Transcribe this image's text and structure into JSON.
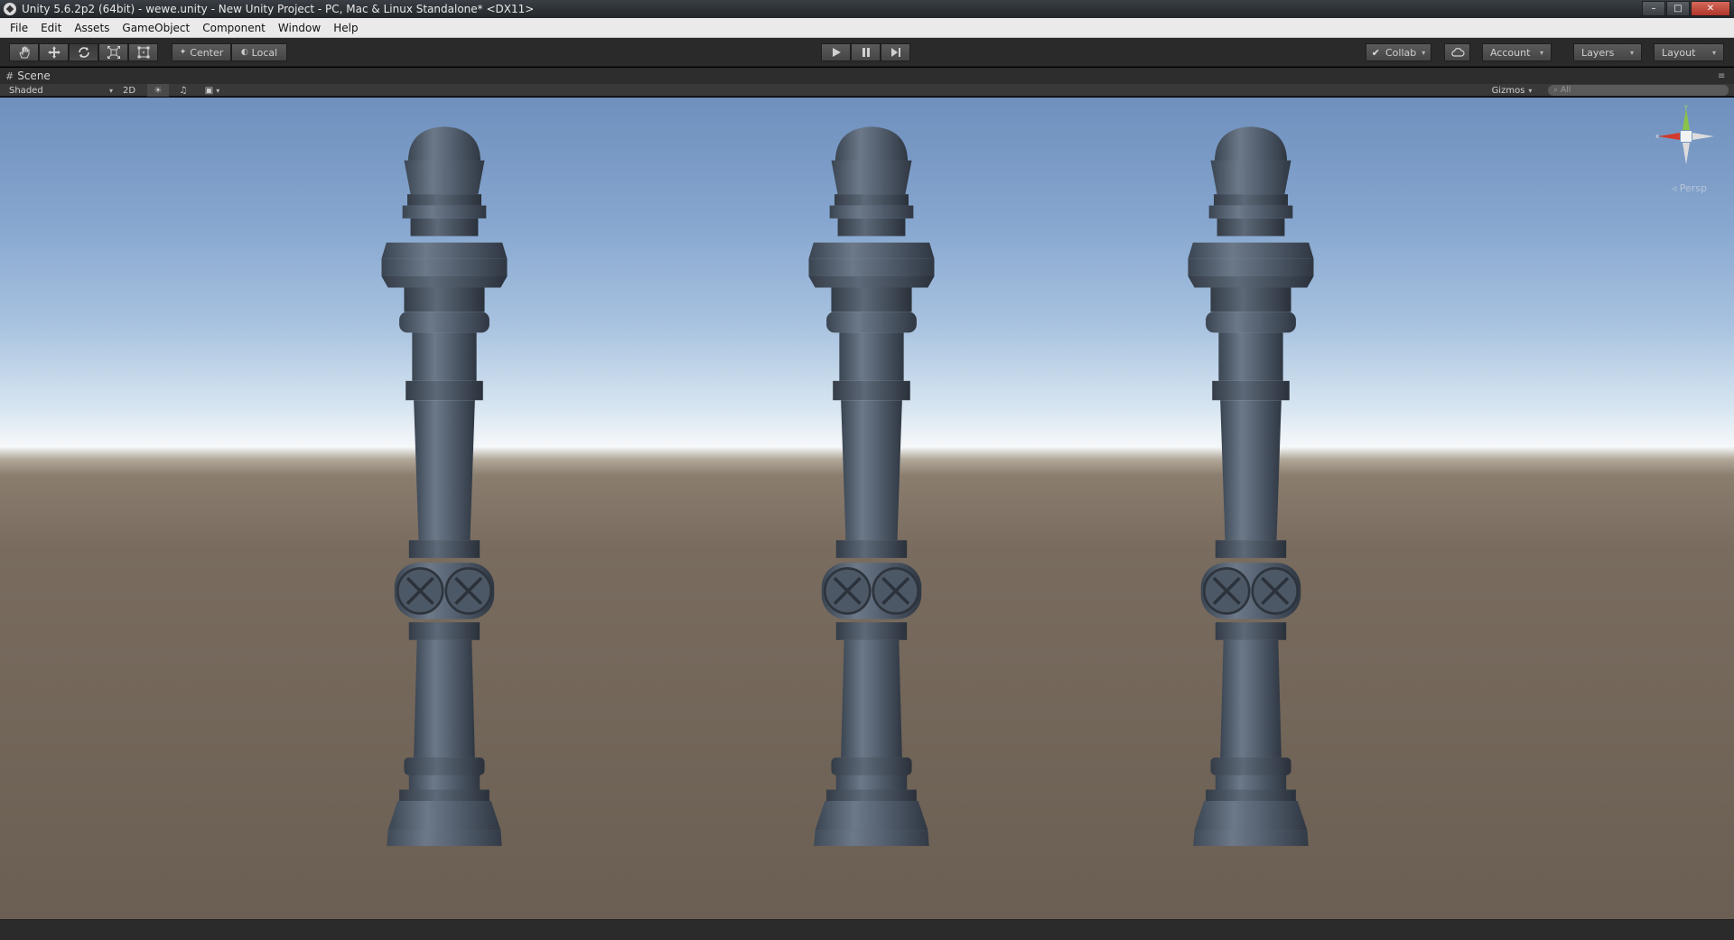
{
  "window": {
    "title": "Unity 5.6.2p2 (64bit) - wewe.unity - New Unity Project - PC, Mac & Linux Standalone* <DX11>",
    "controls": [
      "minimize",
      "maximize",
      "close"
    ]
  },
  "menu": {
    "items": [
      {
        "label": "File"
      },
      {
        "label": "Edit"
      },
      {
        "label": "Assets"
      },
      {
        "label": "GameObject"
      },
      {
        "label": "Component"
      },
      {
        "label": "Window"
      },
      {
        "label": "Help"
      }
    ]
  },
  "toolbar": {
    "tools": [
      {
        "name": "hand-tool",
        "icon": "hand-icon"
      },
      {
        "name": "move-tool",
        "icon": "move-icon"
      },
      {
        "name": "rotate-tool",
        "icon": "rotate-icon",
        "active": true
      },
      {
        "name": "scale-tool",
        "icon": "scale-icon"
      },
      {
        "name": "rect-tool",
        "icon": "rect-icon"
      }
    ],
    "pivot_label": "Center",
    "space_label": "Local",
    "collab_label": "Collab",
    "account_label": "Account",
    "layers_label": "Layers",
    "layout_label": "Layout"
  },
  "scene": {
    "tab_label": "Scene",
    "draw_mode": "Shaded",
    "toggle_2d": "2D",
    "gizmos_label": "Gizmos",
    "search_placeholder": "All",
    "projection_label": "Persp",
    "gizmo_axes": {
      "y": "y",
      "x": "x"
    }
  },
  "colors": {
    "sky_top": "#6f8fbd",
    "horizon": "#f6f8fa",
    "ground": "#6b5f53",
    "pillar_metal": "#5a6676",
    "gizmo_y": "#8bc34a",
    "gizmo_x": "#d23a2c"
  }
}
